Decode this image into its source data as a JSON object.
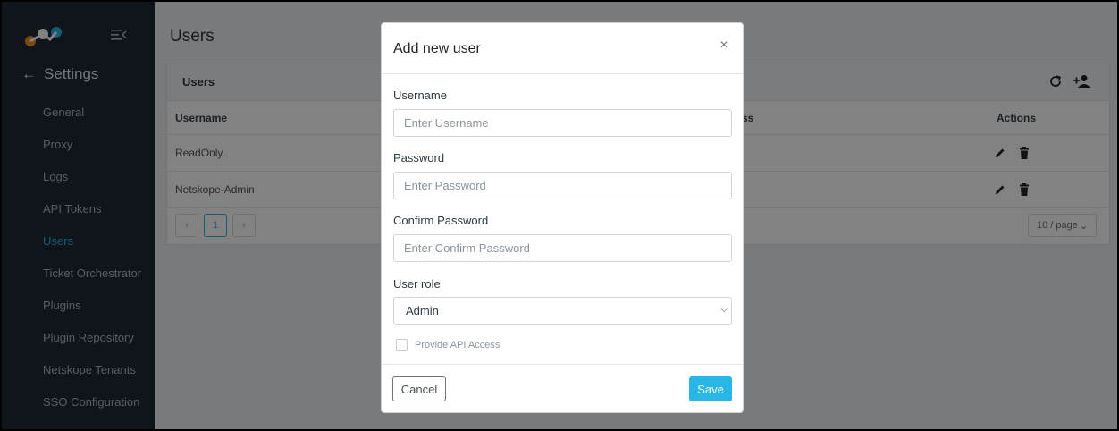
{
  "sidebar": {
    "heading": "Settings",
    "items": [
      {
        "label": "General"
      },
      {
        "label": "Proxy"
      },
      {
        "label": "Logs"
      },
      {
        "label": "API Tokens"
      },
      {
        "label": "Users",
        "active": true
      },
      {
        "label": "Ticket Orchestrator"
      },
      {
        "label": "Plugins"
      },
      {
        "label": "Plugin Repository"
      },
      {
        "label": "Netskope Tenants"
      },
      {
        "label": "SSO Configuration"
      }
    ]
  },
  "main": {
    "page_title": "Users",
    "card_title": "Users",
    "columns": {
      "username": "Username",
      "status": "ss",
      "actions": "Actions"
    },
    "rows": [
      {
        "username": "ReadOnly"
      },
      {
        "username": "Netskope-Admin"
      }
    ],
    "pagination": {
      "current_page": "1",
      "page_size": "10 / page"
    }
  },
  "modal": {
    "title": "Add new user",
    "username_label": "Username",
    "username_placeholder": "Enter Username",
    "password_label": "Password",
    "password_placeholder": "Enter Password",
    "confirm_label": "Confirm Password",
    "confirm_placeholder": "Enter Confirm Password",
    "role_label": "User role",
    "role_value": "Admin",
    "api_access_label": "Provide API Access",
    "cancel_label": "Cancel",
    "save_label": "Save"
  },
  "colors": {
    "accent": "#29b6e6",
    "sidebar_bg": "#1e2a33"
  }
}
